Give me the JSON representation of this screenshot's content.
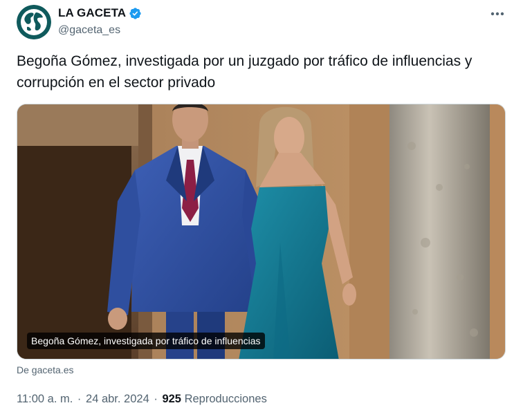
{
  "author": {
    "name": "LA GACETA",
    "handle": "@gaceta_es",
    "verified_color": "#1d9bf0",
    "avatar_icon": "globe-icon"
  },
  "tweet": {
    "text": "Begoña Gómez, investigada por un juzgado por tráfico de influencias y corrupción en el sector privado"
  },
  "media": {
    "caption": "Begoña Gómez, investigada por tráfico de influencias",
    "source": "De gaceta.es"
  },
  "meta": {
    "time": "11:00 a. m.",
    "separator": "·",
    "date": "24 abr. 2024",
    "views_count": "925",
    "views_label": "Reproducciones"
  },
  "colors": {
    "text_primary": "#0f1419",
    "text_secondary": "#536471",
    "avatar_bg": "#0f5a5c"
  }
}
